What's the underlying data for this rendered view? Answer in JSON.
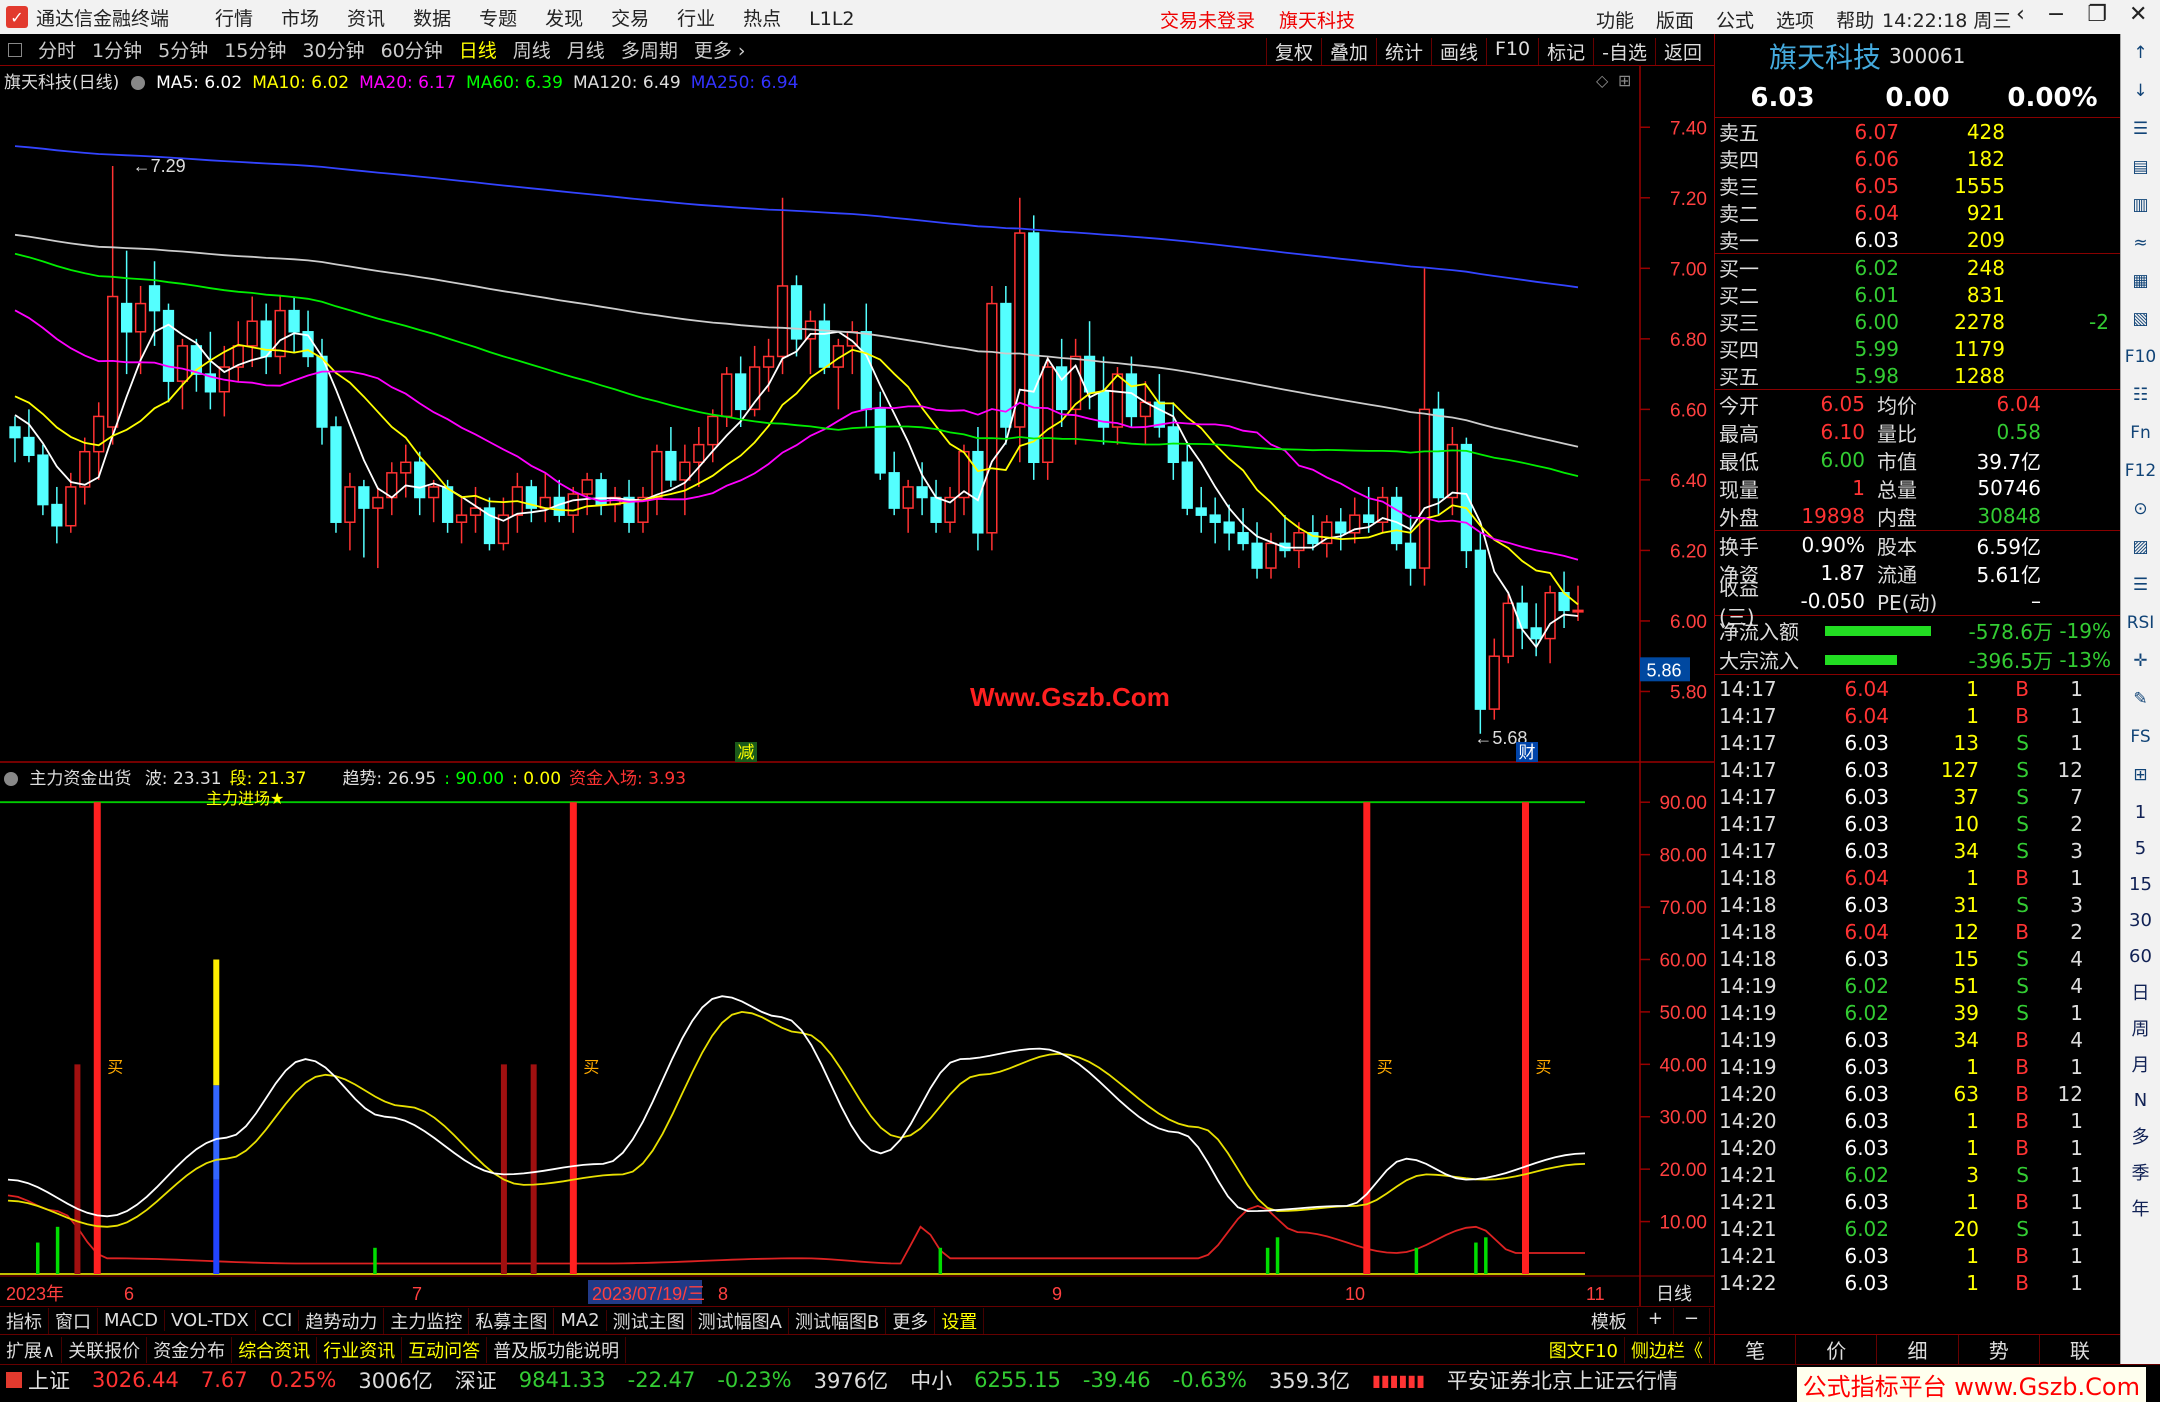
{
  "titlebar": {
    "app": "通达信金融终端",
    "menus": [
      "行情",
      "市场",
      "资讯",
      "数据",
      "专题",
      "发现",
      "交易",
      "行业",
      "热点",
      "L1L2"
    ],
    "center": [
      "交易未登录",
      "旗天科技"
    ],
    "right": [
      "功能",
      "版面",
      "公式",
      "选项",
      "帮助"
    ],
    "clock": "14:22:18",
    "weekday": "周三",
    "win": [
      "‹",
      "−",
      "❐",
      "✕"
    ]
  },
  "periods": [
    "分时",
    "1分钟",
    "5分钟",
    "15分钟",
    "30分钟",
    "60分钟",
    "日线",
    "周线",
    "月线",
    "多周期",
    "更多 ›"
  ],
  "active_period": "日线",
  "tools": [
    "复权",
    "叠加",
    "统计",
    "画线",
    "F10",
    "标记",
    "-自选",
    "返回"
  ],
  "kline": {
    "title": "旗天科技(日线)",
    "ma": [
      {
        "label": "MA5: 6.02",
        "color": "#ffffff"
      },
      {
        "label": "MA10: 6.02",
        "color": "#ffff00"
      },
      {
        "label": "MA20: 6.17",
        "color": "#ff00ff"
      },
      {
        "label": "MA60: 6.39",
        "color": "#00ff00"
      },
      {
        "label": "MA120: 6.49",
        "color": "#dddddd"
      },
      {
        "label": "MA250: 6.94",
        "color": "#3333ff"
      }
    ],
    "hi_label": "7.29",
    "lo_label": "5.68",
    "price_tag": "5.86",
    "watermark": "Www.Gszb.Com",
    "marker_a": "减",
    "marker_b": "财"
  },
  "indicator": {
    "title": "主力资金出货",
    "labels": [
      {
        "t": "波: 23.31",
        "c": "#dddddd"
      },
      {
        "t": "段: 21.37",
        "c": "#ffff00"
      },
      {
        "t": "趋势: 26.95",
        "c": "#dddddd"
      },
      {
        "t": ": 90.00",
        "c": "#00ff00"
      },
      {
        "t": ": 0.00",
        "c": "#ffff00"
      },
      {
        "t": "资金入场: 3.93",
        "c": "#ff3333"
      }
    ],
    "signal": "主力进场★",
    "buy": "买"
  },
  "dates": {
    "labels": [
      "2023年",
      "6",
      "7",
      "2023/07/19/三",
      "8",
      "9",
      "10",
      "11"
    ],
    "period_label": "日线"
  },
  "tabs1": [
    "指标",
    "窗口",
    "MACD",
    "VOL-TDX",
    "CCI",
    "趋势动力",
    "主力监控",
    "私募主图",
    "MA2",
    "测试主图",
    "测试幅图A",
    "测试幅图B",
    "更多",
    "设置"
  ],
  "tabs1_right": [
    "模板",
    "+",
    "−"
  ],
  "tabs2": [
    "扩展∧",
    "关联报价",
    "资金分布",
    "综合资讯",
    "行业资讯",
    "互动问答",
    "普及版功能说明"
  ],
  "tabs2_right": [
    "图文F10",
    "侧边栏《"
  ],
  "chart_data": [
    {
      "type": "candlestick",
      "title": "旗天科技(日线)",
      "ylim": [
        5.6,
        7.5
      ],
      "ma": {
        "MA5": 6.02,
        "MA10": 6.02,
        "MA20": 6.17,
        "MA60": 6.39,
        "MA120": 6.49,
        "MA250": 6.94
      },
      "yticks": [
        7.4,
        7.2,
        7.0,
        6.8,
        6.6,
        6.4,
        6.2,
        6.0,
        5.8
      ],
      "candles": [
        [
          6.55,
          6.58,
          6.45,
          6.52
        ],
        [
          6.52,
          6.6,
          6.45,
          6.47
        ],
        [
          6.47,
          6.5,
          6.3,
          6.33
        ],
        [
          6.33,
          6.38,
          6.22,
          6.27
        ],
        [
          6.27,
          6.42,
          6.25,
          6.38
        ],
        [
          6.38,
          6.52,
          6.33,
          6.48
        ],
        [
          6.48,
          6.62,
          6.4,
          6.58
        ],
        [
          6.55,
          7.29,
          6.5,
          6.92
        ],
        [
          6.9,
          7.05,
          6.7,
          6.82
        ],
        [
          6.82,
          6.95,
          6.7,
          6.9
        ],
        [
          6.95,
          7.02,
          6.78,
          6.88
        ],
        [
          6.88,
          6.9,
          6.62,
          6.68
        ],
        [
          6.68,
          6.8,
          6.6,
          6.78
        ],
        [
          6.78,
          6.8,
          6.65,
          6.7
        ],
        [
          6.7,
          6.82,
          6.6,
          6.65
        ],
        [
          6.65,
          6.78,
          6.58,
          6.72
        ],
        [
          6.72,
          6.85,
          6.68,
          6.78
        ],
        [
          6.78,
          6.92,
          6.72,
          6.85
        ],
        [
          6.85,
          6.9,
          6.7,
          6.75
        ],
        [
          6.75,
          6.92,
          6.7,
          6.88
        ],
        [
          6.88,
          6.92,
          6.76,
          6.82
        ],
        [
          6.82,
          6.88,
          6.72,
          6.75
        ],
        [
          6.75,
          6.8,
          6.5,
          6.55
        ],
        [
          6.55,
          6.58,
          6.25,
          6.28
        ],
        [
          6.28,
          6.42,
          6.2,
          6.38
        ],
        [
          6.38,
          6.4,
          6.18,
          6.32
        ],
        [
          6.32,
          6.38,
          6.15,
          6.35
        ],
        [
          6.35,
          6.45,
          6.3,
          6.42
        ],
        [
          6.42,
          6.5,
          6.35,
          6.45
        ],
        [
          6.45,
          6.48,
          6.3,
          6.35
        ],
        [
          6.35,
          6.4,
          6.28,
          6.38
        ],
        [
          6.38,
          6.4,
          6.25,
          6.28
        ],
        [
          6.28,
          6.35,
          6.22,
          6.3
        ],
        [
          6.3,
          6.38,
          6.25,
          6.32
        ],
        [
          6.32,
          6.35,
          6.2,
          6.22
        ],
        [
          6.22,
          6.35,
          6.2,
          6.3
        ],
        [
          6.3,
          6.42,
          6.25,
          6.38
        ],
        [
          6.38,
          6.4,
          6.28,
          6.32
        ],
        [
          6.32,
          6.42,
          6.28,
          6.35
        ],
        [
          6.35,
          6.4,
          6.28,
          6.3
        ],
        [
          6.3,
          6.38,
          6.25,
          6.36
        ],
        [
          6.36,
          6.42,
          6.3,
          6.4
        ],
        [
          6.4,
          6.42,
          6.3,
          6.33
        ],
        [
          6.33,
          6.38,
          6.28,
          6.35
        ],
        [
          6.35,
          6.4,
          6.25,
          6.28
        ],
        [
          6.28,
          6.38,
          6.25,
          6.35
        ],
        [
          6.35,
          6.5,
          6.3,
          6.48
        ],
        [
          6.48,
          6.55,
          6.38,
          6.4
        ],
        [
          6.4,
          6.5,
          6.3,
          6.45
        ],
        [
          6.45,
          6.55,
          6.38,
          6.5
        ],
        [
          6.5,
          6.6,
          6.45,
          6.58
        ],
        [
          6.58,
          6.72,
          6.55,
          6.7
        ],
        [
          6.7,
          6.75,
          6.55,
          6.6
        ],
        [
          6.6,
          6.78,
          6.58,
          6.72
        ],
        [
          6.72,
          6.8,
          6.65,
          6.75
        ],
        [
          6.75,
          7.2,
          6.7,
          6.95
        ],
        [
          6.95,
          6.98,
          6.75,
          6.8
        ],
        [
          6.8,
          6.88,
          6.7,
          6.85
        ],
        [
          6.85,
          6.9,
          6.7,
          6.72
        ],
        [
          6.72,
          6.8,
          6.6,
          6.78
        ],
        [
          6.78,
          6.85,
          6.7,
          6.82
        ],
        [
          6.82,
          6.9,
          6.55,
          6.6
        ],
        [
          6.6,
          6.65,
          6.4,
          6.42
        ],
        [
          6.42,
          6.48,
          6.3,
          6.32
        ],
        [
          6.32,
          6.4,
          6.25,
          6.38
        ],
        [
          6.38,
          6.45,
          6.3,
          6.35
        ],
        [
          6.35,
          6.4,
          6.25,
          6.28
        ],
        [
          6.28,
          6.38,
          6.25,
          6.35
        ],
        [
          6.35,
          6.5,
          6.3,
          6.48
        ],
        [
          6.48,
          6.55,
          6.2,
          6.25
        ],
        [
          6.25,
          6.95,
          6.2,
          6.9
        ],
        [
          6.9,
          6.95,
          6.5,
          6.55
        ],
        [
          6.55,
          7.2,
          6.45,
          7.1
        ],
        [
          7.1,
          7.15,
          6.4,
          6.45
        ],
        [
          6.45,
          6.75,
          6.4,
          6.72
        ],
        [
          6.72,
          6.8,
          6.55,
          6.6
        ],
        [
          6.6,
          6.8,
          6.5,
          6.75
        ],
        [
          6.75,
          6.85,
          6.6,
          6.65
        ],
        [
          6.65,
          6.75,
          6.5,
          6.55
        ],
        [
          6.55,
          6.72,
          6.5,
          6.7
        ],
        [
          6.7,
          6.75,
          6.55,
          6.58
        ],
        [
          6.58,
          6.68,
          6.5,
          6.62
        ],
        [
          6.62,
          6.7,
          6.52,
          6.55
        ],
        [
          6.55,
          6.62,
          6.4,
          6.45
        ],
        [
          6.45,
          6.5,
          6.3,
          6.32
        ],
        [
          6.32,
          6.38,
          6.25,
          6.3
        ],
        [
          6.3,
          6.35,
          6.22,
          6.28
        ],
        [
          6.28,
          6.33,
          6.2,
          6.25
        ],
        [
          6.25,
          6.32,
          6.2,
          6.22
        ],
        [
          6.22,
          6.28,
          6.12,
          6.15
        ],
        [
          6.15,
          6.25,
          6.12,
          6.22
        ],
        [
          6.22,
          6.3,
          6.18,
          6.2
        ],
        [
          6.2,
          6.28,
          6.15,
          6.25
        ],
        [
          6.25,
          6.3,
          6.2,
          6.22
        ],
        [
          6.22,
          6.3,
          6.18,
          6.28
        ],
        [
          6.28,
          6.32,
          6.2,
          6.25
        ],
        [
          6.25,
          6.35,
          6.22,
          6.3
        ],
        [
          6.3,
          6.38,
          6.25,
          6.28
        ],
        [
          6.28,
          6.38,
          6.25,
          6.35
        ],
        [
          6.35,
          6.38,
          6.2,
          6.22
        ],
        [
          6.22,
          6.3,
          6.1,
          6.15
        ],
        [
          6.15,
          7.0,
          6.1,
          6.6
        ],
        [
          6.6,
          6.65,
          6.3,
          6.35
        ],
        [
          6.35,
          6.55,
          6.3,
          6.5
        ],
        [
          6.5,
          6.52,
          6.15,
          6.2
        ],
        [
          6.2,
          6.25,
          5.68,
          5.75
        ],
        [
          5.75,
          5.95,
          5.72,
          5.9
        ],
        [
          5.9,
          6.08,
          5.88,
          6.05
        ],
        [
          6.05,
          6.1,
          5.92,
          5.98
        ],
        [
          5.98,
          6.05,
          5.9,
          5.95
        ],
        [
          5.95,
          6.1,
          5.88,
          6.08
        ],
        [
          6.08,
          6.14,
          5.98,
          6.03
        ],
        [
          6.03,
          6.1,
          6.0,
          6.03
        ]
      ]
    },
    {
      "type": "line",
      "title": "主力资金出货",
      "ylim": [
        0,
        95
      ],
      "yticks": [
        90,
        80,
        70,
        60,
        50,
        40,
        30,
        20,
        10
      ],
      "series": [
        {
          "name": "波",
          "value": 23.31
        },
        {
          "name": "段",
          "value": 21.37
        },
        {
          "name": "资金入场",
          "value": 3.93
        }
      ],
      "buy_signals": [
        "买",
        "买",
        "买",
        "买"
      ]
    }
  ],
  "quote": {
    "name": "旗天科技",
    "code": "300061",
    "price": "6.03",
    "change": "0.00",
    "pct": "0.00%",
    "asks": [
      {
        "l": "卖五",
        "p": "6.07",
        "v": "428",
        "c": ""
      },
      {
        "l": "卖四",
        "p": "6.06",
        "v": "182",
        "c": ""
      },
      {
        "l": "卖三",
        "p": "6.05",
        "v": "1555",
        "c": ""
      },
      {
        "l": "卖二",
        "p": "6.04",
        "v": "921",
        "c": ""
      },
      {
        "l": "卖一",
        "p": "6.03",
        "v": "209",
        "c": ""
      }
    ],
    "bids": [
      {
        "l": "买一",
        "p": "6.02",
        "v": "248",
        "c": ""
      },
      {
        "l": "买二",
        "p": "6.01",
        "v": "831",
        "c": ""
      },
      {
        "l": "买三",
        "p": "6.00",
        "v": "2278",
        "c": "-2"
      },
      {
        "l": "买四",
        "p": "5.99",
        "v": "1179",
        "c": ""
      },
      {
        "l": "买五",
        "p": "5.98",
        "v": "1288",
        "c": ""
      }
    ],
    "stats": [
      {
        "k": "今开",
        "v": "6.05",
        "k2": "均价",
        "v2": "6.04"
      },
      {
        "k": "最高",
        "v": "6.10",
        "k2": "量比",
        "v2": "0.58"
      },
      {
        "k": "最低",
        "v": "6.00",
        "k2": "市值",
        "v2": "39.7亿"
      },
      {
        "k": "现量",
        "v": "1",
        "k2": "总量",
        "v2": "50746"
      },
      {
        "k": "外盘",
        "v": "19898",
        "k2": "内盘",
        "v2": "30848"
      }
    ],
    "stats2": [
      {
        "k": "换手",
        "v": "0.90%",
        "k2": "股本",
        "v2": "6.59亿"
      },
      {
        "k": "净资",
        "v": "1.87",
        "k2": "流通",
        "v2": "5.61亿"
      },
      {
        "k": "收益(三)",
        "v": "-0.050",
        "k2": "PE(动)",
        "v2": "–"
      }
    ],
    "flows": [
      {
        "k": "净流入额",
        "v": "-578.6万",
        "p": "-19%"
      },
      {
        "k": "大宗流入",
        "v": "-396.5万",
        "p": "-13%"
      }
    ],
    "ticks": [
      [
        "14:17",
        "6.04",
        "1",
        "B",
        "1"
      ],
      [
        "14:17",
        "6.04",
        "1",
        "B",
        "1"
      ],
      [
        "14:17",
        "6.03",
        "13",
        "S",
        "1"
      ],
      [
        "14:17",
        "6.03",
        "127",
        "S",
        "12"
      ],
      [
        "14:17",
        "6.03",
        "37",
        "S",
        "7"
      ],
      [
        "14:17",
        "6.03",
        "10",
        "S",
        "2"
      ],
      [
        "14:17",
        "6.03",
        "34",
        "S",
        "3"
      ],
      [
        "14:18",
        "6.04",
        "1",
        "B",
        "1"
      ],
      [
        "14:18",
        "6.03",
        "31",
        "S",
        "3"
      ],
      [
        "14:18",
        "6.04",
        "12",
        "B",
        "2"
      ],
      [
        "14:18",
        "6.03",
        "15",
        "S",
        "4"
      ],
      [
        "14:19",
        "6.02",
        "51",
        "S",
        "4"
      ],
      [
        "14:19",
        "6.02",
        "39",
        "S",
        "1"
      ],
      [
        "14:19",
        "6.03",
        "34",
        "B",
        "4"
      ],
      [
        "14:19",
        "6.03",
        "1",
        "B",
        "1"
      ],
      [
        "14:20",
        "6.03",
        "63",
        "B",
        "12"
      ],
      [
        "14:20",
        "6.03",
        "1",
        "B",
        "1"
      ],
      [
        "14:20",
        "6.03",
        "1",
        "B",
        "1"
      ],
      [
        "14:21",
        "6.02",
        "3",
        "S",
        "1"
      ],
      [
        "14:21",
        "6.03",
        "1",
        "B",
        "1"
      ],
      [
        "14:21",
        "6.02",
        "20",
        "S",
        "1"
      ],
      [
        "14:21",
        "6.03",
        "1",
        "B",
        "1"
      ],
      [
        "14:22",
        "6.03",
        "1",
        "B",
        "1"
      ]
    ],
    "foot": [
      "笔",
      "价",
      "细",
      "势",
      "联"
    ]
  },
  "status": {
    "items": [
      {
        "n": "上证",
        "v": "3026.44",
        "c": "7.67",
        "p": "0.25%",
        "a": "3006亿",
        "up": true
      },
      {
        "n": "深证",
        "v": "9841.33",
        "c": "-22.47",
        "p": "-0.23%",
        "a": "3976亿",
        "up": false
      },
      {
        "n": "中小",
        "v": "6255.15",
        "c": "-39.46",
        "p": "-0.63%",
        "a": "359.3亿",
        "up": false
      }
    ],
    "broker": "平安证券北京上证云行情",
    "wm": "公式指标平台 www.Gszb.Com"
  },
  "sidebar": [
    "↑",
    "↓",
    "☰",
    "▤",
    "▥",
    "≈",
    "▦",
    "▧",
    "F10",
    "☷",
    "Fn",
    "F12",
    "⊙",
    "▨",
    "☰",
    "RSI",
    "✛",
    "✎",
    "FS",
    "⊞",
    "1",
    "5",
    "15",
    "30",
    "60",
    "日",
    "周",
    "月",
    "N",
    "多",
    "季",
    "年"
  ]
}
